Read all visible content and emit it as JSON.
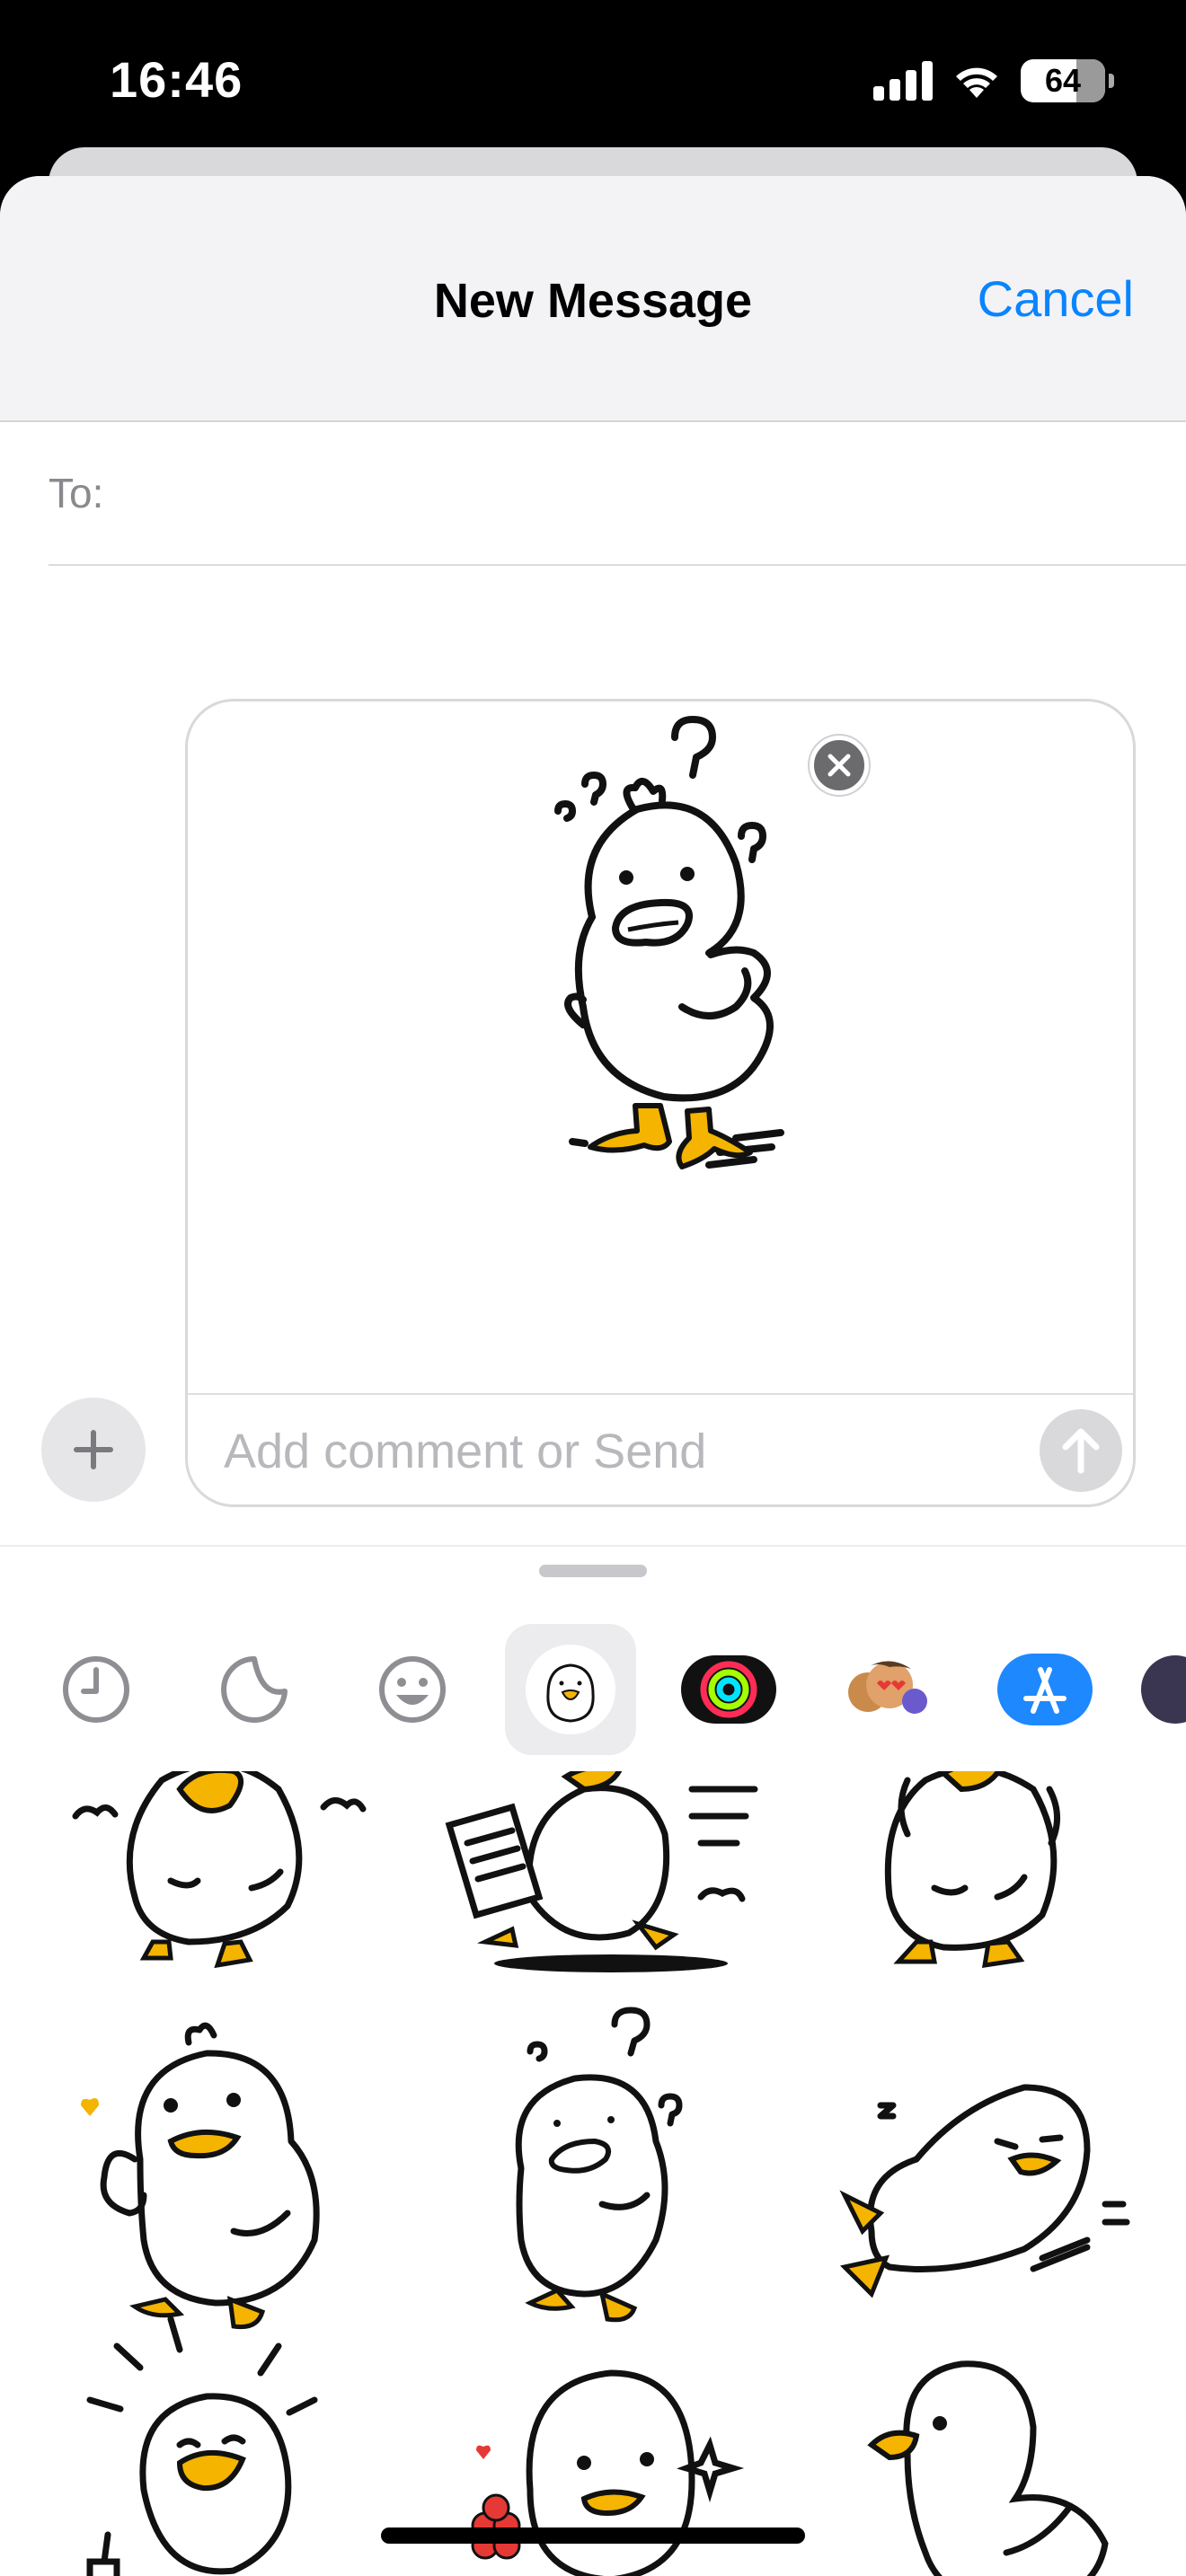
{
  "status_bar": {
    "time": "16:46",
    "battery": "64"
  },
  "nav": {
    "title": "New Message",
    "cancel_label": "Cancel"
  },
  "recipient": {
    "label": "To:",
    "value": ""
  },
  "compose": {
    "placeholder": "Add comment or Send",
    "remove_icon": "close-icon",
    "send_icon": "arrow-up-icon"
  },
  "plus_icon": "plus-icon",
  "app_tray": [
    {
      "name": "recents",
      "icon": "clock-icon"
    },
    {
      "name": "stickers",
      "icon": "sticker-icon"
    },
    {
      "name": "emoji",
      "icon": "smiley-icon"
    },
    {
      "name": "duck-stickers",
      "icon": "duck-sticker-icon",
      "selected": true
    },
    {
      "name": "activity",
      "icon": "activity-rings-icon"
    },
    {
      "name": "memoji",
      "icon": "memoji-icon"
    },
    {
      "name": "app-store",
      "icon": "app-store-icon"
    }
  ],
  "stickers": [
    {
      "name": "duck-shouting"
    },
    {
      "name": "duck-reading-running"
    },
    {
      "name": "duck-crying"
    },
    {
      "name": "duck-thumbs-up"
    },
    {
      "name": "duck-confused"
    },
    {
      "name": "duck-sleeping"
    },
    {
      "name": "duck-excited-drinking"
    },
    {
      "name": "duck-flower"
    },
    {
      "name": "duck-side"
    }
  ],
  "colors": {
    "accent": "#0a84ff",
    "beak": "#f4b400",
    "flower": "#e53935"
  }
}
